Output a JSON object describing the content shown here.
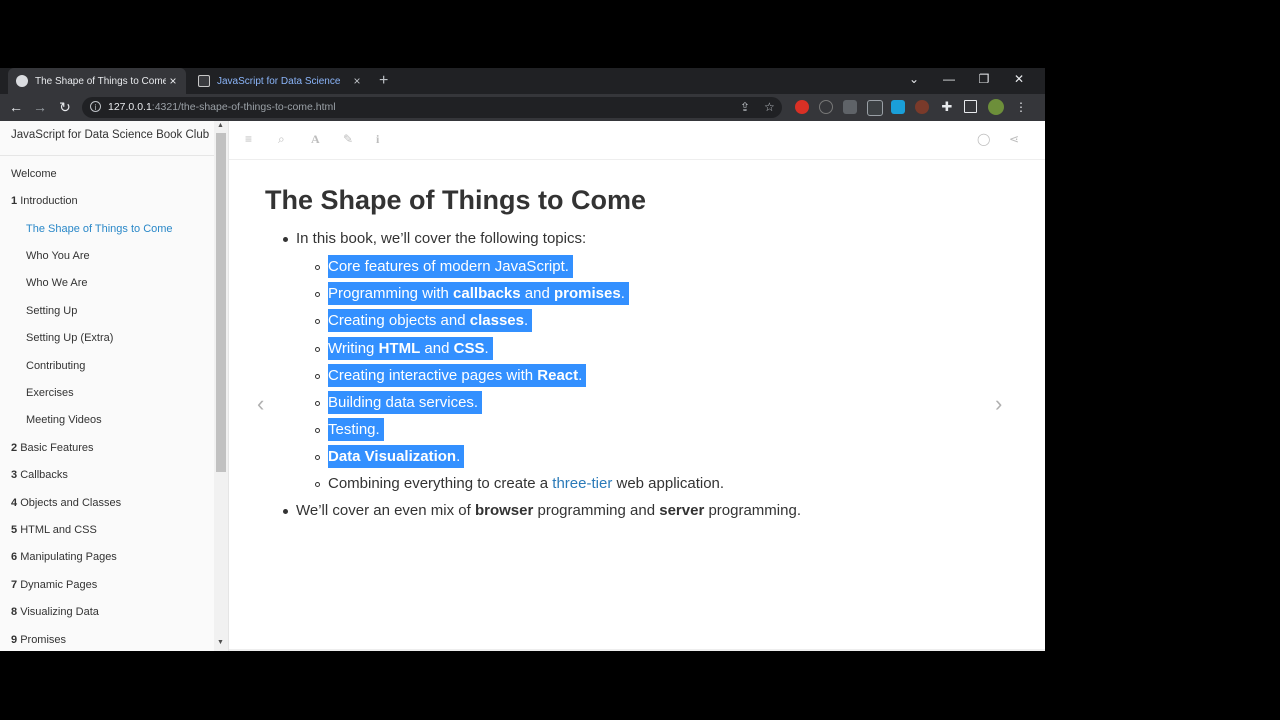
{
  "browser": {
    "tabs": [
      {
        "title": "The Shape of Things to Come | J",
        "close": "×"
      },
      {
        "title": "JavaScript for Data Science",
        "close": "×"
      }
    ],
    "new_tab": "+",
    "window_controls": {
      "dropdown": "⌄",
      "minimize": "—",
      "restore": "❐",
      "close": "✕"
    },
    "nav": {
      "back": "←",
      "forward": "→",
      "reload": "↻"
    },
    "url_host": "127.0.0.1",
    "url_rest": ":4321/the-shape-of-things-to-come.html"
  },
  "sidebar": {
    "title": "JavaScript for Data Science Book Club",
    "items": [
      {
        "num": "",
        "label": "Welcome"
      },
      {
        "num": "1",
        "label": "Introduction"
      },
      {
        "num": "",
        "label": "The Shape of Things to Come"
      },
      {
        "num": "",
        "label": "Who You Are"
      },
      {
        "num": "",
        "label": "Who We Are"
      },
      {
        "num": "",
        "label": "Setting Up"
      },
      {
        "num": "",
        "label": "Setting Up (Extra)"
      },
      {
        "num": "",
        "label": "Contributing"
      },
      {
        "num": "",
        "label": "Exercises"
      },
      {
        "num": "",
        "label": "Meeting Videos"
      },
      {
        "num": "2",
        "label": "Basic Features"
      },
      {
        "num": "3",
        "label": "Callbacks"
      },
      {
        "num": "4",
        "label": "Objects and Classes"
      },
      {
        "num": "5",
        "label": "HTML and CSS"
      },
      {
        "num": "6",
        "label": "Manipulating Pages"
      },
      {
        "num": "7",
        "label": "Dynamic Pages"
      },
      {
        "num": "8",
        "label": "Visualizing Data"
      },
      {
        "num": "9",
        "label": "Promises"
      }
    ]
  },
  "page": {
    "title": "The Shape of Things to Come",
    "intro": "In this book, we’ll cover the following topics:",
    "topics": [
      {
        "parts": [
          {
            "t": "Core features of modern JavaScript."
          }
        ]
      },
      {
        "parts": [
          {
            "t": "Programming with "
          },
          {
            "t": "callbacks",
            "b": true
          },
          {
            "t": " and "
          },
          {
            "t": "promises",
            "b": true
          },
          {
            "t": "."
          }
        ]
      },
      {
        "parts": [
          {
            "t": "Creating objects and "
          },
          {
            "t": "classes",
            "b": true
          },
          {
            "t": "."
          }
        ]
      },
      {
        "parts": [
          {
            "t": "Writing "
          },
          {
            "t": "HTML",
            "b": true
          },
          {
            "t": " and "
          },
          {
            "t": "CSS",
            "b": true
          },
          {
            "t": "."
          }
        ]
      },
      {
        "parts": [
          {
            "t": "Creating interactive pages with "
          },
          {
            "t": "React",
            "b": true
          },
          {
            "t": "."
          }
        ]
      },
      {
        "parts": [
          {
            "t": "Building data services."
          }
        ]
      },
      {
        "parts": [
          {
            "t": "Testing."
          }
        ]
      },
      {
        "parts": [
          {
            "t": "Data Visualization",
            "b": true
          },
          {
            "t": "."
          }
        ]
      }
    ],
    "last_topic": {
      "before": "Combining everything to create a ",
      "link": "three-tier",
      "after": " web application."
    },
    "closing": {
      "p1": "We’ll cover an even mix of ",
      "b1": "browser",
      "p2": " programming and ",
      "b2": "server",
      "p3": " programming."
    },
    "prev_arrow": "‹",
    "next_arrow": "›"
  }
}
